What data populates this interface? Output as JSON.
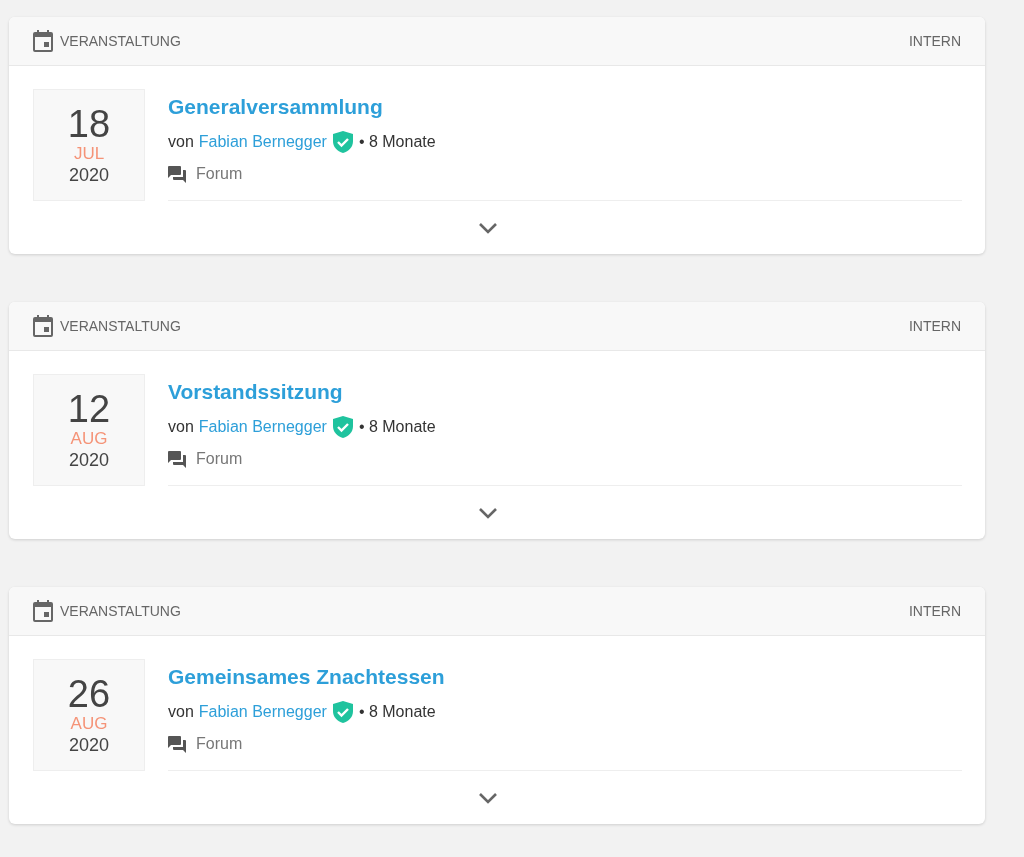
{
  "posts": [
    {
      "category": "VERANSTALTUNG",
      "visibility": "INTERN",
      "day": "18",
      "month": "JUL",
      "year": "2020",
      "title": "Generalversammlung",
      "by": "von",
      "author": "Fabian Bernegger",
      "verified": true,
      "age": "• 8 Monate",
      "forum": "Forum"
    },
    {
      "category": "VERANSTALTUNG",
      "visibility": "INTERN",
      "day": "12",
      "month": "AUG",
      "year": "2020",
      "title": "Vorstandssitzung",
      "by": "von",
      "author": "Fabian Bernegger",
      "verified": true,
      "age": "• 8 Monate",
      "forum": "Forum"
    },
    {
      "category": "VERANSTALTUNG",
      "visibility": "INTERN",
      "day": "26",
      "month": "AUG",
      "year": "2020",
      "title": "Gemeinsames Znachtessen",
      "by": "von",
      "author": "Fabian Bernegger",
      "verified": true,
      "age": "• 8 Monate",
      "forum": "Forum"
    }
  ]
}
